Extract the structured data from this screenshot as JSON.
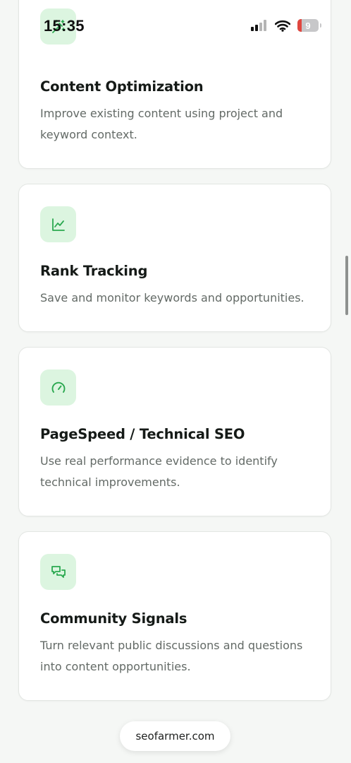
{
  "status_bar": {
    "time": "15:35",
    "battery_level": "9",
    "icons": [
      "cellular-signal-icon",
      "wifi-icon",
      "battery-icon"
    ]
  },
  "features": [
    {
      "icon": "magic-wand-icon",
      "title": "Content Optimization",
      "description": "Improve existing content using project and keyword context."
    },
    {
      "icon": "line-chart-icon",
      "title": "Rank Tracking",
      "description": "Save and monitor keywords and opportunities."
    },
    {
      "icon": "gauge-icon",
      "title": "PageSpeed / Technical SEO",
      "description": "Use real performance evidence to identify technical improvements."
    },
    {
      "icon": "chat-bubbles-icon",
      "title": "Community Signals",
      "description": "Turn relevant public discussions and questions into content opportunities."
    }
  ],
  "browser": {
    "url": "seofarmer.com"
  },
  "colors": {
    "accent": "#22a046",
    "icon_tile": "#dcf5e0",
    "card_border": "#e3e6e3",
    "background": "#f5f7f5"
  }
}
